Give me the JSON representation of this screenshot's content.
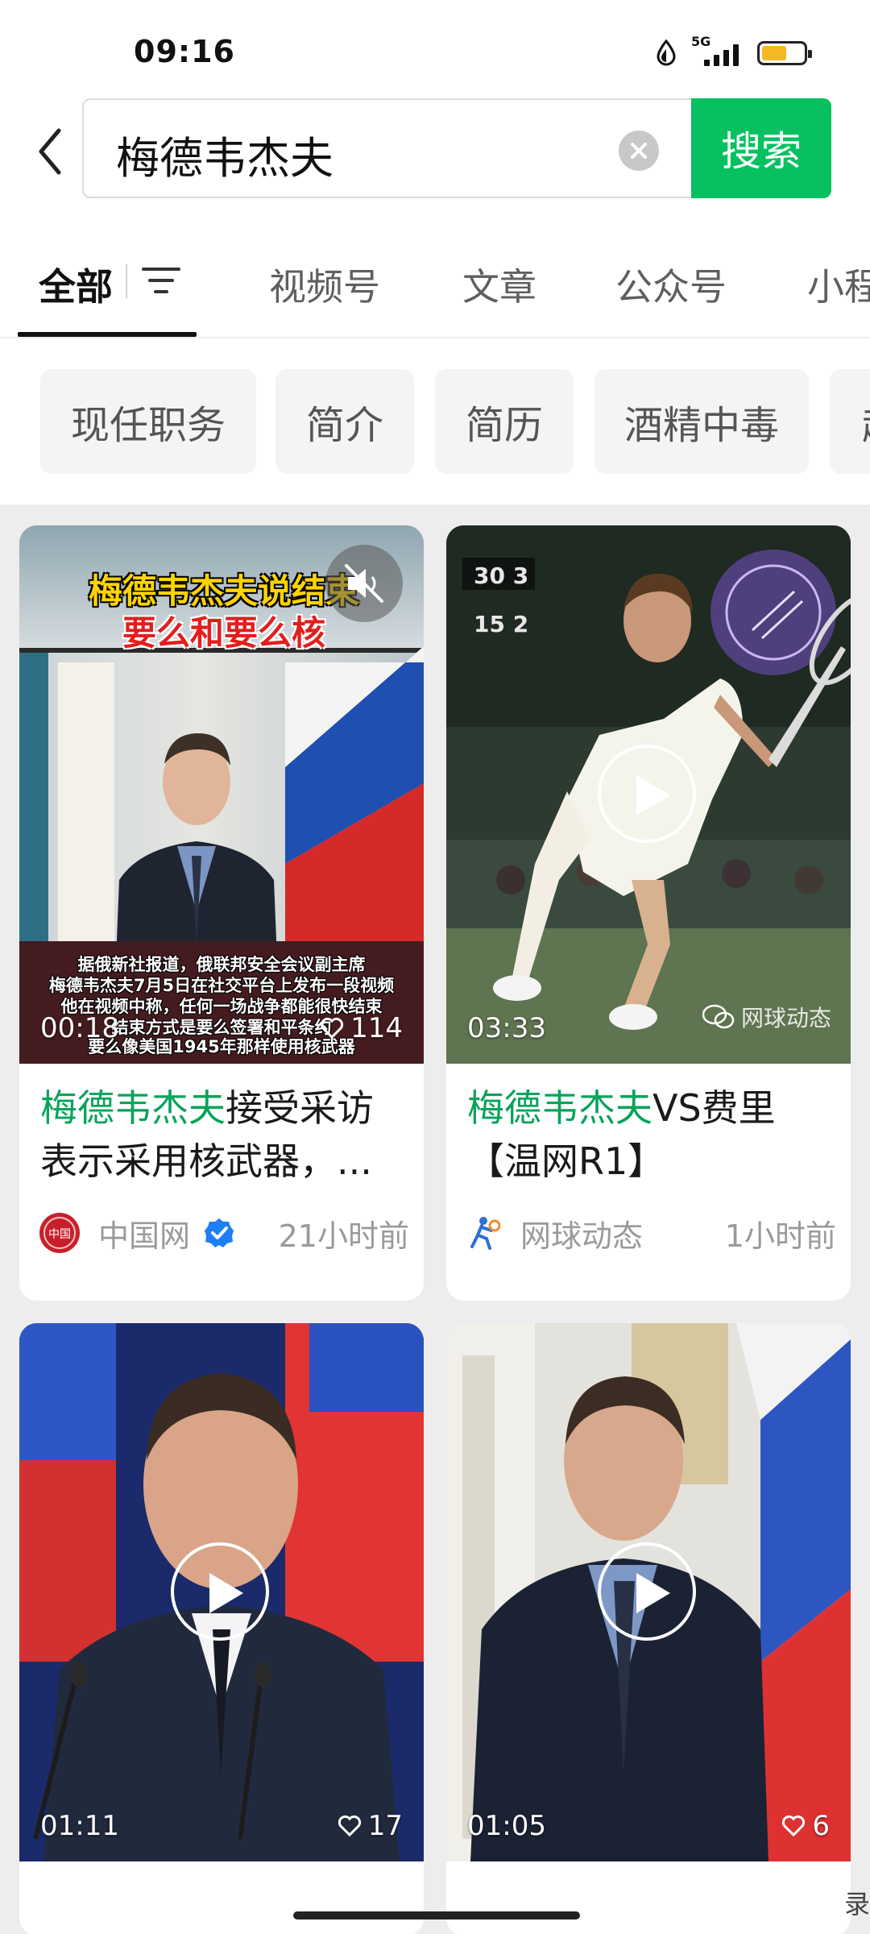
{
  "status_bar": {
    "time": "09:16",
    "network": "5G",
    "battery_percent": 60,
    "accent": "#f5b824"
  },
  "search": {
    "query": "梅德韦杰夫",
    "button_label": "搜索",
    "button_color": "#07c160"
  },
  "tabs": [
    {
      "label": "全部",
      "active": true
    },
    {
      "label": "视频号",
      "active": false
    },
    {
      "label": "文章",
      "active": false
    },
    {
      "label": "公众号",
      "active": false
    },
    {
      "label": "小程",
      "active": false
    }
  ],
  "chips": [
    {
      "label": "现任职务"
    },
    {
      "label": "简介"
    },
    {
      "label": "简历"
    },
    {
      "label": "酒精中毒"
    },
    {
      "label": "起"
    }
  ],
  "cards": [
    {
      "caption_top": "梅德韦杰夫说结束",
      "caption_red": "要么和要么核",
      "subtitles": [
        "据俄新社报道，俄联邦安全会议副主席",
        "梅德韦杰夫7月5日在社交平台上发布一段视频",
        "他在视频中称，任何一场战争都能很快结束",
        "结束方式是要么签署和平条约",
        "要么像美国1945年那样使用核武器"
      ],
      "duration": "00:18",
      "likes": "114",
      "title_highlight": "梅德韦杰夫",
      "title_rest": "接受采访表示采用核武器，...",
      "source": "中国网",
      "verified": true,
      "time": "21小时前"
    },
    {
      "duration": "03:33",
      "watermark": "网球动态",
      "title_highlight": "梅德韦杰夫",
      "title_rest": "VS费里【温网R1】",
      "source": "网球动态",
      "time": "1小时前"
    },
    {
      "duration": "01:11",
      "likes": "17"
    },
    {
      "duration": "01:05",
      "likes": "6"
    }
  ],
  "partial_text": {
    "corner": "录"
  }
}
